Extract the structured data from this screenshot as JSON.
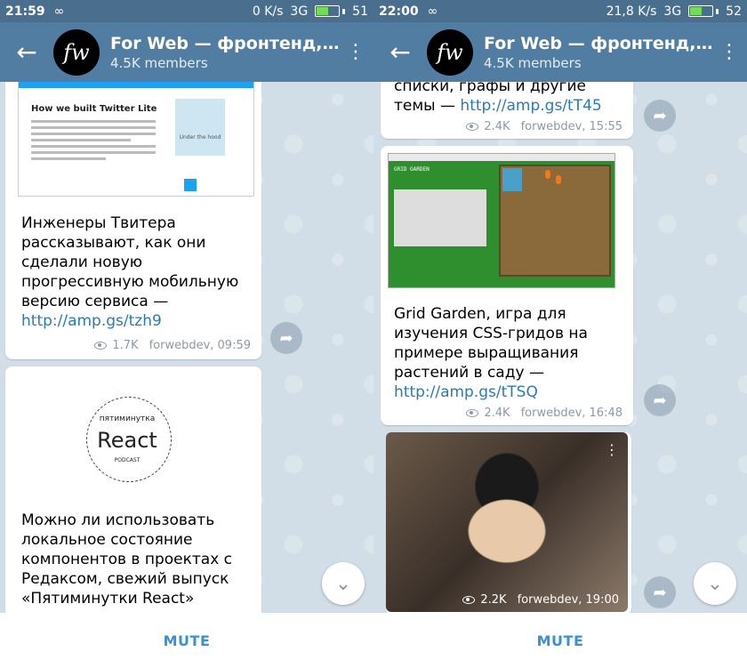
{
  "left": {
    "status": {
      "time": "21:59",
      "infinity": "∞",
      "speed": "0 K/s",
      "signal": "3G",
      "battery": "51"
    },
    "header": {
      "title": "For Web — фронтенд,…",
      "subtitle": "4.5K members",
      "logo": "fw"
    },
    "messages": [
      {
        "thumb_title": "How we built Twitter Lite",
        "thumb_card": "Under the hood",
        "text": "Инженеры Твитера рассказывают, как они сделали новую прогрессивную мобильную версию сервиса — ",
        "link": "http://amp.gs/tzh9",
        "views": "1.7K",
        "author_time": "forwebdev, 09:59"
      },
      {
        "thumb_top": "пятиминутка",
        "thumb_main": "React",
        "thumb_sub": "PODCAST",
        "text": "Можно ли использовать локальное состояние компонентов в проектах с Редаксом, свежий выпуск «Пятиминутки React»"
      }
    ],
    "mute": "MUTE"
  },
  "right": {
    "status": {
      "time": "22:00",
      "infinity": "∞",
      "speed": "21,8 K/s",
      "signal": "3G",
      "battery": "52"
    },
    "header": {
      "title": "For Web — фронтенд,…",
      "subtitle": "4.5K members",
      "logo": "fw"
    },
    "messages": [
      {
        "text": "списки, графы и другие темы — ",
        "link": "http://amp.gs/tT45",
        "views": "2.4K",
        "author_time": "forwebdev, 15:55"
      },
      {
        "thumb_title": "GRID GARDEN",
        "text": "Grid Garden, игра для изучения CSS-гридов на примере выращивания растений в саду — ",
        "link": "http://amp.gs/tTSQ",
        "views": "2.4K",
        "author_time": "forwebdev, 16:48"
      },
      {
        "views": "2.2K",
        "author_time": "forwebdev, 19:00"
      }
    ],
    "mute": "MUTE"
  },
  "icons": {
    "back": "arrow-left-icon",
    "menu": "more-vertical-icon",
    "share": "share-icon",
    "scroll": "chevron-down-icon",
    "views": "eye-icon"
  },
  "colors": {
    "header": "#517da2",
    "statusbar": "#4a6f8e",
    "link": "#2a7ab8",
    "mute": "#3a8fd6"
  }
}
